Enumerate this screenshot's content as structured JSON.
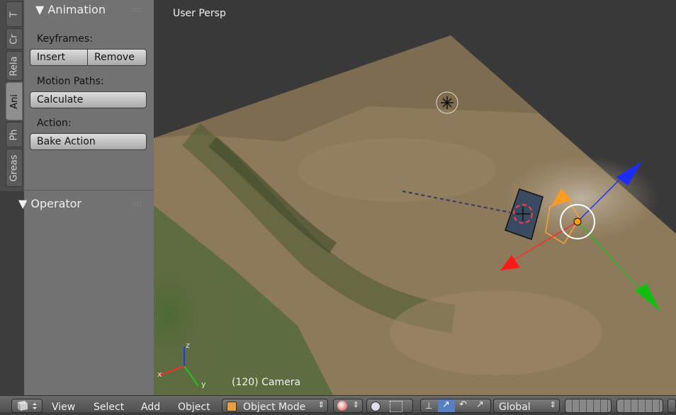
{
  "tool_tabs": [
    "T",
    "Cr",
    "Rela",
    "Ani",
    "Ph",
    "Greas"
  ],
  "animation_panel": {
    "title": "▼ Animation",
    "keyframes_label": "Keyframes:",
    "insert_label": "Insert",
    "remove_label": "Remove",
    "motion_paths_label": "Motion Paths:",
    "calculate_label": "Calculate",
    "action_label": "Action:",
    "bake_action_label": "Bake Action"
  },
  "operator_panel": {
    "title": "▼ Operator"
  },
  "viewport": {
    "title": "User Persp",
    "object_label": "(120) Camera"
  },
  "axes": {
    "x": "x",
    "y": "y",
    "z": "z"
  },
  "header": {
    "menus": [
      "View",
      "Select",
      "Add",
      "Object"
    ],
    "mode": "Object Mode",
    "orientation": "Global"
  }
}
